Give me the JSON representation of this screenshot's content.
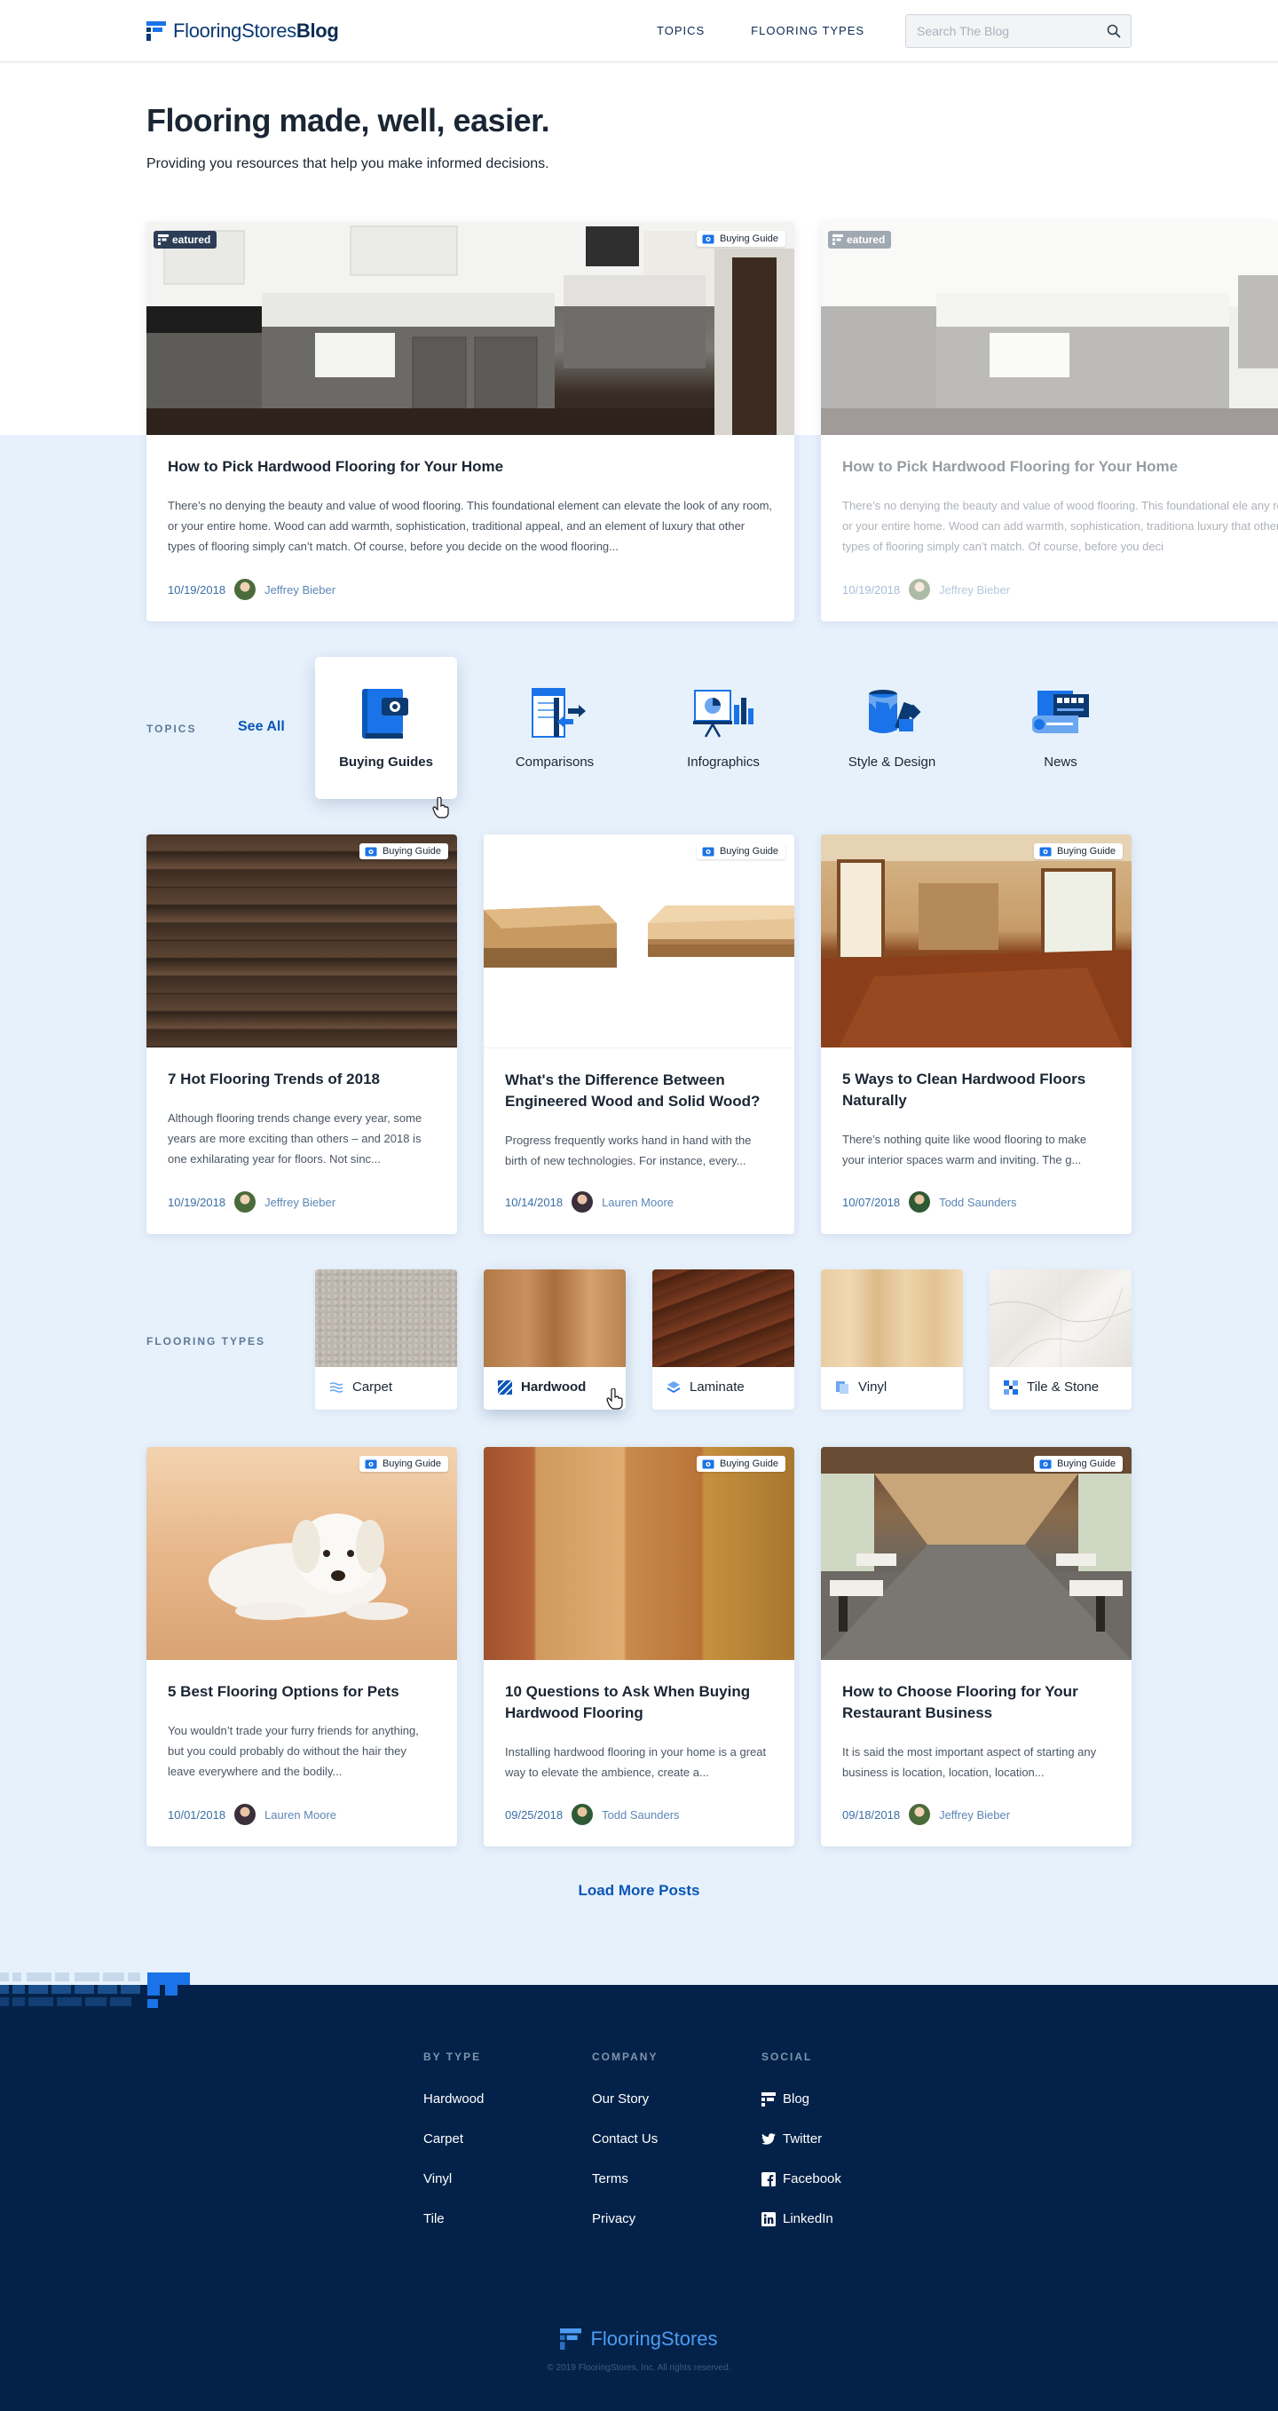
{
  "header": {
    "logo_brand": "FlooringStores",
    "logo_suffix": "Blog",
    "nav": [
      "TOPICS",
      "FLOORING TYPES"
    ],
    "search_placeholder": "Search The Blog"
  },
  "hero": {
    "title": "Flooring made, well, easier.",
    "subtitle": "Providing you resources that help you make informed decisions."
  },
  "featured": {
    "badge_featured": "eatured",
    "badge_type": "Buying Guide",
    "title": "How to Pick Hardwood Flooring for Your Home",
    "excerpt": "There’s no denying the beauty and value of wood flooring.  This foundational element can elevate the look of any room, or your entire home.  Wood can add warmth, sophistication, traditional appeal, and an element of luxury that other types of flooring simply can’t match.  Of course, before you decide on the wood flooring...",
    "date": "10/19/2018",
    "author": "Jeffrey Bieber"
  },
  "featured_next": {
    "badge_featured": "eatured",
    "title": "How to Pick Hardwood Flooring for Your Home",
    "excerpt": "There’s no denying the beauty and value of wood flooring.  This foundational ele any room, or your entire home.  Wood can add warmth, sophistication, traditiona luxury that other types of flooring simply can’t match.  Of course, before you deci",
    "date": "10/19/2018",
    "author": "Jeffrey Bieber"
  },
  "topics": {
    "label": "TOPICS",
    "see_all": "See All",
    "items": [
      {
        "label": "Buying Guides"
      },
      {
        "label": "Comparisons"
      },
      {
        "label": "Infographics"
      },
      {
        "label": "Style & Design"
      },
      {
        "label": "News"
      }
    ]
  },
  "posts_row1": [
    {
      "badge": "Buying Guide",
      "title": "7 Hot Flooring Trends of 2018",
      "excerpt": "Although flooring trends change every year, some years are more exciting than others – and 2018 is one exhilarating year for floors. Not sinc...",
      "date": "10/19/2018",
      "author": "Jeffrey Bieber"
    },
    {
      "badge": "Buying Guide",
      "title": "What's the Difference Between Engineered Wood and Solid Wood?",
      "excerpt": "Progress frequently works hand in hand with the birth of new technologies. For instance, every...",
      "date": "10/14/2018",
      "author": "Lauren Moore"
    },
    {
      "badge": "Buying Guide",
      "title": "5 Ways to Clean Hardwood Floors Naturally",
      "excerpt": "There’s nothing quite like wood flooring to make your interior spaces warm and inviting.  The g...",
      "date": "10/07/2018",
      "author": "Todd Saunders"
    }
  ],
  "flooring_types": {
    "label": "FLOORING TYPES",
    "items": [
      {
        "label": "Carpet"
      },
      {
        "label": "Hardwood"
      },
      {
        "label": "Laminate"
      },
      {
        "label": "Vinyl"
      },
      {
        "label": "Tile & Stone"
      }
    ]
  },
  "posts_row2": [
    {
      "badge": "Buying Guide",
      "title": "5 Best Flooring Options for Pets",
      "excerpt": "You wouldn’t trade your furry friends for anything, but you could probably do without the hair they leave everywhere and the bodily...",
      "date": "10/01/2018",
      "author": "Lauren Moore"
    },
    {
      "badge": "Buying Guide",
      "title": "10 Questions to Ask When Buying Hardwood Flooring",
      "excerpt": "Installing hardwood flooring in your home is a great way to elevate the ambience, create a...",
      "date": "09/25/2018",
      "author": "Todd Saunders"
    },
    {
      "badge": "Buying Guide",
      "title": "How to Choose Flooring for Your Restaurant Business",
      "excerpt": "It is said the most important aspect of starting any business is location, location, location...",
      "date": "09/18/2018",
      "author": "Jeffrey Bieber"
    }
  ],
  "load_more": "Load More Posts",
  "footer": {
    "columns": [
      {
        "heading": "BY TYPE",
        "links": [
          "Hardwood",
          "Carpet",
          "Vinyl",
          "Tile"
        ]
      },
      {
        "heading": "COMPANY",
        "links": [
          "Our Story",
          "Contact Us",
          "Terms",
          "Privacy"
        ]
      },
      {
        "heading": "SOCIAL",
        "links": [
          "Blog",
          "Twitter",
          "Facebook",
          "LinkedIn"
        ],
        "icons": [
          "blog-icon",
          "twitter-icon",
          "facebook-icon",
          "linkedin-icon"
        ]
      }
    ],
    "brand": "FlooringStores",
    "copyright": "© 2019 FlooringStores, Inc. All rights reserved."
  },
  "colors": {
    "brand_dark": "#042249",
    "accent_blue": "#0a57b6",
    "light_bg": "#e7f1fc"
  }
}
